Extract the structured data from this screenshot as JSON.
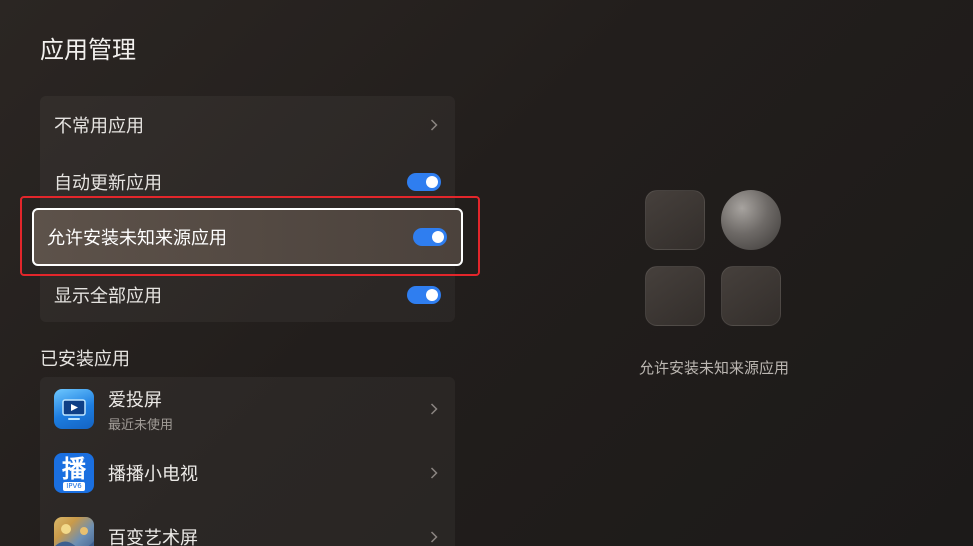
{
  "page": {
    "title": "应用管理"
  },
  "settings": {
    "items": [
      {
        "label": "不常用应用",
        "control": "chevron"
      },
      {
        "label": "自动更新应用",
        "control": "toggle",
        "on": true
      },
      {
        "label": "允许安装未知来源应用",
        "control": "toggle",
        "on": true,
        "focused": true
      },
      {
        "label": "显示全部应用",
        "control": "toggle",
        "on": true
      }
    ]
  },
  "installed": {
    "title": "已安装应用",
    "apps": [
      {
        "name": "爱投屏",
        "subtitle": "最近未使用",
        "icon": "tv-cast-icon"
      },
      {
        "name": "播播小电视",
        "icon": "bobo-tv-icon",
        "icon_glyph": "播",
        "icon_badge": "IPV6"
      },
      {
        "name": "百变艺术屏",
        "icon": "art-screen-icon"
      }
    ]
  },
  "preview": {
    "caption": "允许安装未知来源应用"
  },
  "colors": {
    "accent": "#2f7ef0",
    "focus_border": "#ffffff",
    "annotation_red": "#e3262b"
  }
}
